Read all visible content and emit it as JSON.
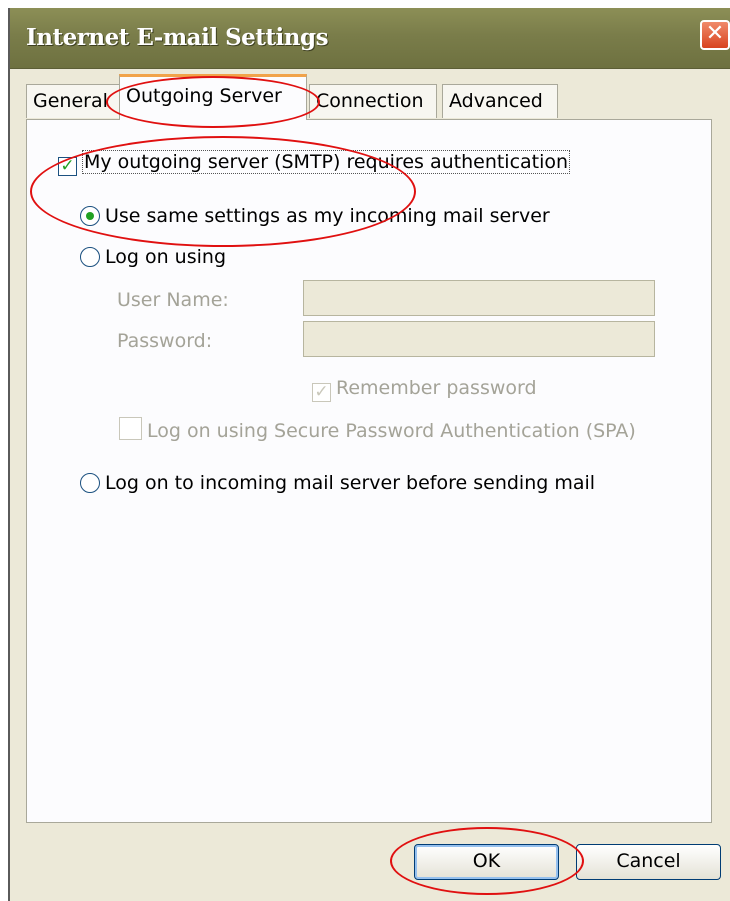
{
  "window": {
    "title": "Internet E-mail Settings",
    "close_label": "✕"
  },
  "tabs": [
    {
      "label": "General"
    },
    {
      "label": "Outgoing Server"
    },
    {
      "label": "Connection"
    },
    {
      "label": "Advanced"
    }
  ],
  "outgoing": {
    "smtp_auth": {
      "label": "My outgoing server (SMTP) requires authentication",
      "checked": true
    },
    "use_same": {
      "label": "Use same settings as my incoming mail server",
      "selected": true
    },
    "log_on_using": {
      "label": "Log on using",
      "selected": false
    },
    "user_name": {
      "label": "User Name:",
      "value": ""
    },
    "password": {
      "label": "Password:",
      "value": ""
    },
    "remember_password": {
      "label": "Remember password",
      "checked": true
    },
    "spa": {
      "label": "Log on using Secure Password Authentication (SPA)",
      "checked": false
    },
    "log_on_incoming": {
      "label": "Log on to incoming mail server before sending mail",
      "selected": false
    }
  },
  "buttons": {
    "ok": "OK",
    "cancel": "Cancel"
  },
  "colors": {
    "annotation": "#e01010",
    "check": "#21a121",
    "titlebar": "#7a7d4a"
  }
}
